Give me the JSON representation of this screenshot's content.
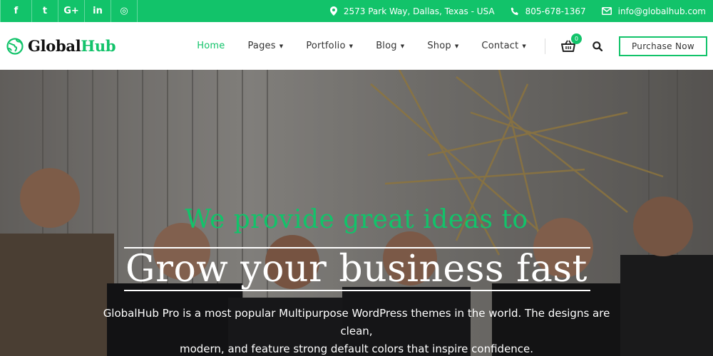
{
  "colors": {
    "accent": "#12c36a",
    "topbar_text": "#ffffff",
    "nav_text": "#333333"
  },
  "topbar": {
    "social": [
      {
        "icon": "facebook-icon",
        "glyph": "f"
      },
      {
        "icon": "twitter-icon",
        "glyph": "t"
      },
      {
        "icon": "google-plus-icon",
        "glyph": "G+"
      },
      {
        "icon": "linkedin-icon",
        "glyph": "in"
      },
      {
        "icon": "instagram-icon",
        "glyph": "◎"
      }
    ],
    "address": "2573 Park Way, Dallas, Texas - USA",
    "phone": "805-678-1367",
    "email": "info@globalhub.com"
  },
  "header": {
    "logo_main": "Global",
    "logo_accent": "Hub",
    "nav": [
      {
        "label": "Home",
        "active": true
      },
      {
        "label": "Pages",
        "dropdown": true
      },
      {
        "label": "Portfolio",
        "dropdown": true
      },
      {
        "label": "Blog",
        "dropdown": true
      },
      {
        "label": "Shop",
        "dropdown": true
      },
      {
        "label": "Contact",
        "dropdown": true
      }
    ],
    "cart_count": "0",
    "purchase_label": "Purchase Now"
  },
  "hero": {
    "tagline": "We provide great ideas to",
    "headline": "Grow your business fast",
    "description_line1": "GlobalHub Pro is a most popular Multipurpose WordPress themes in the world. The designs are clean,",
    "description_line2": "modern, and feature strong default colors that inspire confidence."
  }
}
